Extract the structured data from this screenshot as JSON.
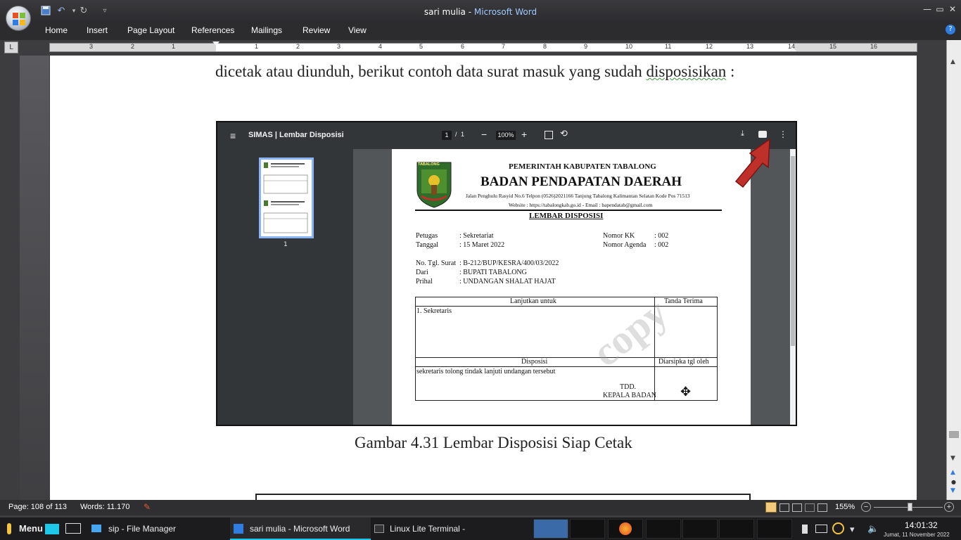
{
  "window": {
    "doc_name": "sari mulia",
    "separator": " - ",
    "app_name": "Microsoft Word"
  },
  "ribbon": {
    "tabs": [
      "Home",
      "Insert",
      "Page Layout",
      "References",
      "Mailings",
      "Review",
      "View"
    ]
  },
  "ruler": {
    "numbers": [
      "3",
      "2",
      "1",
      "1",
      "2",
      "3",
      "4",
      "5",
      "6",
      "7",
      "8",
      "9",
      "10",
      "11",
      "12",
      "13",
      "14",
      "15",
      "16"
    ]
  },
  "document": {
    "line_text_before": "dicetak atau diunduh, berikut contoh data surat masuk yang sudah ",
    "line_text_flagged": "disposisikan",
    "line_text_after": " :",
    "caption": "Gambar 4.31 Lembar Disposisi Siap Cetak"
  },
  "pdf_viewer": {
    "title": "SIMAS | Lembar Disposisi",
    "page_current": "1",
    "page_sep": "/",
    "page_total": "1",
    "zoom": "100%",
    "thumb_label": "1",
    "page": {
      "logo_text": "TABALONG",
      "gov": "PEMERINTAH KABUPATEN TABALONG",
      "agency": "BADAN PENDAPATAN DAERAH",
      "address": "Jalan Penghulu Rasyid No.6 Telpon (0526)2021166 Tanjung Tabalong Kalimantan Selatan Kode Pos 71513",
      "website": "Website : https://tabalongkab.go.id - Email : bapendatab@gmail.com",
      "doc_title": "LEMBAR DISPOSISI",
      "petugas_label": "Petugas",
      "petugas_value": ": Sekretariat",
      "tanggal_label": "Tanggal",
      "tanggal_value": ": 15 Maret 2022",
      "nomor_kk_label": "Nomor KK",
      "nomor_kk_value": ": 002",
      "nomor_agenda_label": "Nomor Agenda",
      "nomor_agenda_value": ": 002",
      "no_surat_label": "No. Tgl. Surat",
      "no_surat_value": ": B-212/BUP/KESRA/400/03/2022",
      "dari_label": "Dari",
      "dari_value": ": BUPATI TABALONG",
      "prihal_label": "Prihal",
      "prihal_value": ": UNDANGAN SHALAT HAJAT",
      "col_lanjutkan": "Lanjutkan untuk",
      "col_tanda": "Tanda Terima",
      "lanjutkan_item": "1. Sekretaris",
      "col_disposisi": "Disposisi",
      "col_diarsip": "Diarsipka tgl oleh",
      "disposisi_text": "sekretaris tolong tindak lanjuti undangan tersebut",
      "tdd": "TDD.",
      "kepala": "KEPALA BADAN",
      "watermark": "copy"
    }
  },
  "status_bar": {
    "page": "Page: 108 of 113",
    "words": "Words: 11.170",
    "zoom": "155%"
  },
  "taskbar": {
    "menu": "Menu",
    "tasks": [
      "sip - File Manager",
      "sari mulia - Microsoft Word",
      "Linux Lite Terminal -"
    ],
    "time": "14:01:32",
    "date": "Jumat, 11 November 2022"
  },
  "colors": {
    "accent": "#2f7de1",
    "arrow": "#c0302b",
    "spelling": "#3a9b3a"
  }
}
